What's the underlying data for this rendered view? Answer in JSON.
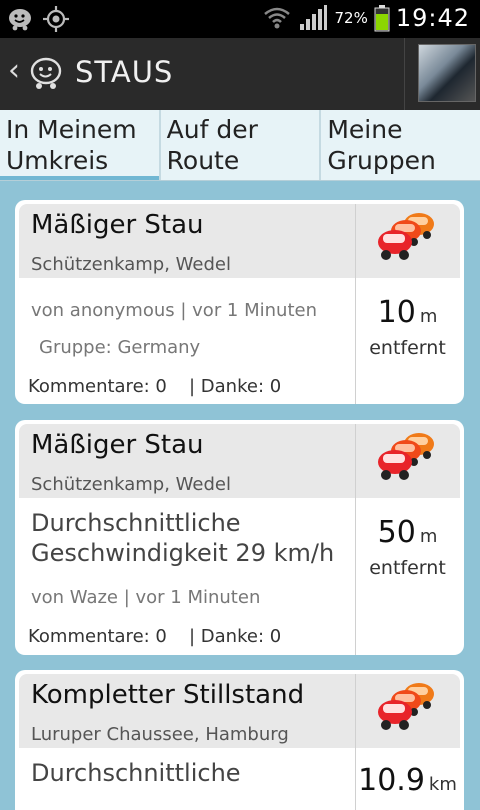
{
  "status_bar": {
    "battery_percent": "72%",
    "time": "19:42",
    "icons": [
      "waze-icon",
      "gps-icon",
      "wifi-icon",
      "signal-icon",
      "battery-icon"
    ]
  },
  "action_bar": {
    "title": "STAUS",
    "back_icon": "chevron-left-icon",
    "logo_icon": "waze-icon"
  },
  "tabs": [
    {
      "line1": "In Meinem",
      "line2": "Umkreis",
      "active": true
    },
    {
      "line1": "Auf der",
      "line2": "Route",
      "active": false
    },
    {
      "line1": "Meine",
      "line2": "Gruppen",
      "active": false
    }
  ],
  "cards": [
    {
      "title": "Mäßiger Stau",
      "street": "Schützenkamp, Wedel",
      "reporter": "von anonymous | vor 1 Minuten",
      "group": "Gruppe: Germany",
      "comments": "Kommentare: 0",
      "thanks": "| Danke: 0",
      "distance_value": "10",
      "distance_unit": "m",
      "distance_label": "entfernt"
    },
    {
      "title": "Mäßiger Stau",
      "street": "Schützenkamp, Wedel",
      "speed_line1": "Durchschnittliche",
      "speed_line2": "Geschwindigkeit 29 km/h",
      "reporter": "von Waze | vor 1 Minuten",
      "comments": "Kommentare: 0",
      "thanks": "| Danke: 0",
      "distance_value": "50",
      "distance_unit": "m",
      "distance_label": "entfernt"
    },
    {
      "title": "Kompletter Stillstand",
      "street": "Luruper Chaussee, Hamburg",
      "speed_line1": "Durchschnittliche",
      "distance_value": "10.9",
      "distance_unit": "km"
    }
  ],
  "colors": {
    "background": "#8fc3d6",
    "active_tab_indicator": "#71b7d3",
    "jam_car_red": "#e8242a",
    "jam_car_orange": "#f07a18"
  }
}
